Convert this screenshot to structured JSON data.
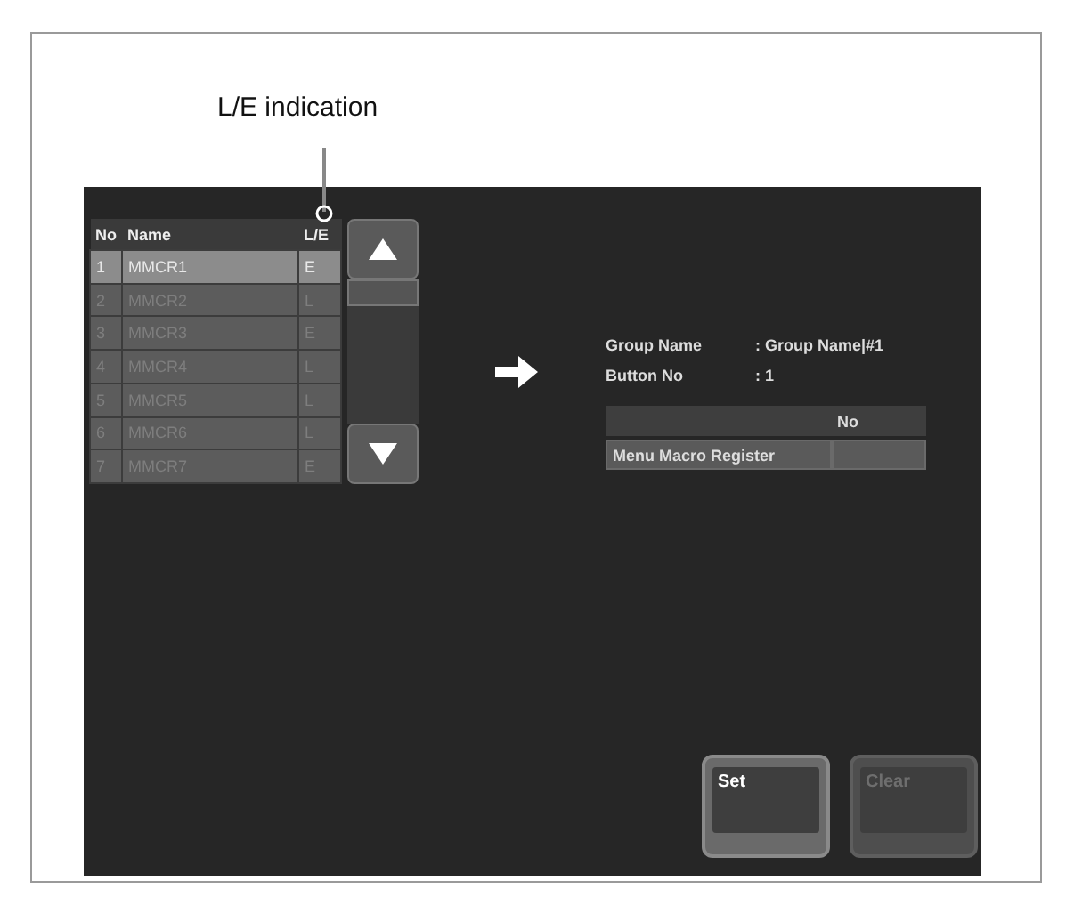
{
  "callout": {
    "label": "L/E indication"
  },
  "list": {
    "columns": [
      "No",
      "Name",
      "L/E"
    ],
    "rows": [
      {
        "no": "1",
        "name": "MMCR1",
        "le": "E",
        "selected": true
      },
      {
        "no": "2",
        "name": "MMCR2",
        "le": "L",
        "selected": false
      },
      {
        "no": "3",
        "name": "MMCR3",
        "le": "E",
        "selected": false
      },
      {
        "no": "4",
        "name": "MMCR4",
        "le": "L",
        "selected": false
      },
      {
        "no": "5",
        "name": "MMCR5",
        "le": "L",
        "selected": false
      },
      {
        "no": "6",
        "name": "MMCR6",
        "le": "L",
        "selected": false
      },
      {
        "no": "7",
        "name": "MMCR7",
        "le": "E",
        "selected": false
      }
    ]
  },
  "info": {
    "fields": [
      {
        "label": "Group Name",
        "value": ": Group Name|#1"
      },
      {
        "label": "Button No",
        "value": ": 1"
      }
    ],
    "table": {
      "column": "No",
      "rows": [
        {
          "label": "Menu Macro Register"
        }
      ]
    }
  },
  "buttons": [
    {
      "label": "Set",
      "disabled": false
    },
    {
      "label": "Clear",
      "disabled": true
    }
  ]
}
